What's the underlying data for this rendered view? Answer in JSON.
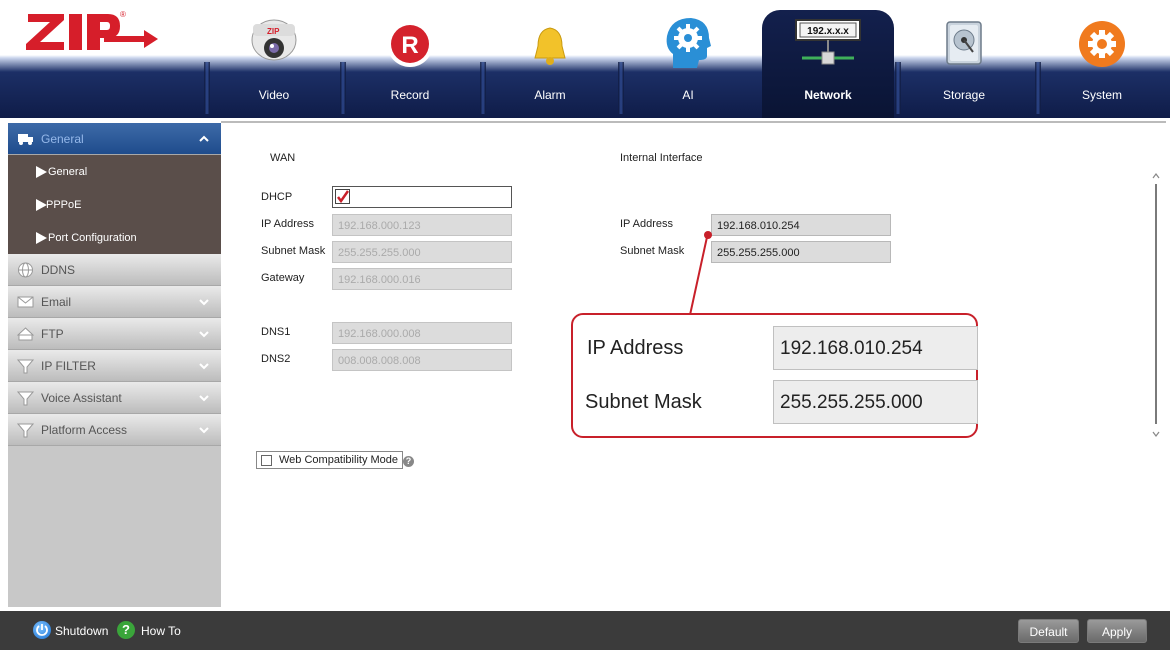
{
  "brand": {
    "logo_text": "ZIP",
    "registered_mark": "®"
  },
  "nav": {
    "tabs": [
      {
        "label": "Video",
        "icon": "camera-icon"
      },
      {
        "label": "Record",
        "icon": "record-icon",
        "icon_text": "R"
      },
      {
        "label": "Alarm",
        "icon": "alarm-bell-icon"
      },
      {
        "label": "AI",
        "icon": "ai-gear-head-icon"
      },
      {
        "label": "Network",
        "icon": "network-icon",
        "icon_text": "192.x.x.x",
        "active": true
      },
      {
        "label": "Storage",
        "icon": "hard-disk-icon"
      },
      {
        "label": "System",
        "icon": "system-gear-icon"
      }
    ]
  },
  "sidebar": {
    "groups": [
      {
        "label": "General",
        "icon": "truck-icon",
        "expanded": true,
        "items": [
          "General",
          "PPPoE",
          "Port Configuration"
        ]
      },
      {
        "label": "DDNS",
        "icon": "globe-icon"
      },
      {
        "label": "Email",
        "icon": "mail-icon"
      },
      {
        "label": "FTP",
        "icon": "ftp-folder-icon"
      },
      {
        "label": "IP FILTER",
        "icon": "filter-icon"
      },
      {
        "label": "Voice Assistant",
        "icon": "filter-icon"
      },
      {
        "label": "Platform Access",
        "icon": "filter-icon"
      }
    ]
  },
  "wan": {
    "title": "WAN",
    "dhcp_label": "DHCP",
    "dhcp_checked": true,
    "ip_label": "IP Address",
    "ip_value": "192.168.000.123",
    "mask_label": "Subnet Mask",
    "mask_value": "255.255.255.000",
    "gateway_label": "Gateway",
    "gateway_value": "192.168.000.016",
    "dns1_label": "DNS1",
    "dns1_value": "192.168.000.008",
    "dns2_label": "DNS2",
    "dns2_value": "008.008.008.008"
  },
  "internal": {
    "title": "Internal Interface",
    "ip_label": "IP Address",
    "ip_value": "192.168.010.254",
    "mask_label": "Subnet Mask",
    "mask_value": "255.255.255.000"
  },
  "callout": {
    "ip_label": "IP Address",
    "ip_value": "192.168.010.254",
    "mask_label": "Subnet Mask",
    "mask_value": "255.255.255.000"
  },
  "web_compat_label": "Web Compatibility Mode",
  "help_glyph": "?",
  "bottom": {
    "shutdown_label": "Shutdown",
    "howto_label": "How To",
    "howto_glyph": "?",
    "default_label": "Default",
    "apply_label": "Apply"
  },
  "colors": {
    "nav_bg": "#0f1c48",
    "sidebar_active": "#1f4c8c",
    "sidebar_sub": "#5a4e4a",
    "callout_border": "#c8202a",
    "bottom_bar": "#3b3b3b"
  }
}
